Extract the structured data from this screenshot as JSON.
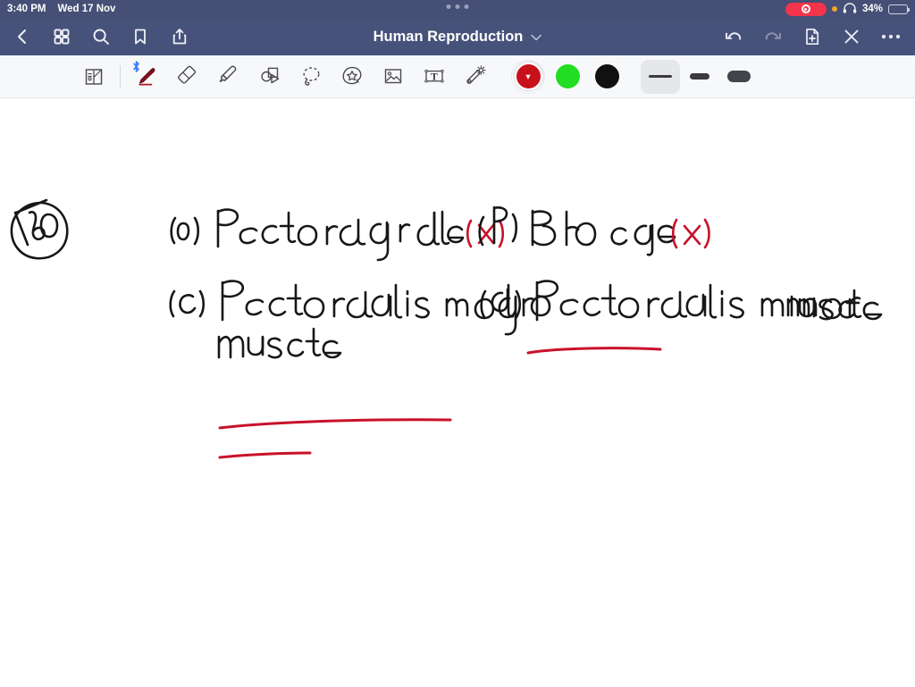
{
  "status_bar": {
    "time": "3:40 PM",
    "date": "Wed 17 Nov",
    "battery_percent": "34%",
    "recording_icon": "record-indicator",
    "orange_dot_icon": "microphone-in-use-dot",
    "headphones_icon": "headphones-icon",
    "battery_icon": "battery-icon",
    "multitask_handle_icon": "multitasking-handle"
  },
  "nav_bar": {
    "title": "Human Reproduction",
    "title_chevron_icon": "chevron-down-icon",
    "left_items": [
      {
        "name": "back-button",
        "icon": "chevron-left-icon"
      },
      {
        "name": "page-grid-button",
        "icon": "grid-icon"
      },
      {
        "name": "search-button",
        "icon": "search-icon"
      },
      {
        "name": "bookmark-button",
        "icon": "bookmark-icon"
      },
      {
        "name": "share-button",
        "icon": "share-icon"
      }
    ],
    "right_items": [
      {
        "name": "undo-button",
        "icon": "undo-icon",
        "enabled": "true"
      },
      {
        "name": "redo-button",
        "icon": "redo-icon",
        "enabled": "false"
      },
      {
        "name": "add-page-button",
        "icon": "add-page-icon"
      },
      {
        "name": "close-button",
        "icon": "close-icon"
      },
      {
        "name": "more-options-button",
        "icon": "ellipsis-icon"
      }
    ]
  },
  "toolbar": {
    "tools": [
      {
        "name": "page-layers-tool",
        "icon": "page-layers-icon",
        "selected": "false"
      },
      {
        "name": "pen-tool",
        "icon": "pen-icon",
        "selected": "true",
        "bluetooth_badge": "ᛒ"
      },
      {
        "name": "eraser-tool",
        "icon": "eraser-icon",
        "selected": "false"
      },
      {
        "name": "highlighter-tool",
        "icon": "highlighter-icon",
        "selected": "false"
      },
      {
        "name": "shapes-tool",
        "icon": "shapes-icon",
        "selected": "false"
      },
      {
        "name": "lasso-tool",
        "icon": "lasso-icon",
        "selected": "false"
      },
      {
        "name": "sticker-tool",
        "icon": "sticker-star-icon",
        "selected": "false"
      },
      {
        "name": "image-tool",
        "icon": "image-icon",
        "selected": "false"
      },
      {
        "name": "text-box-tool",
        "icon": "text-box-icon",
        "selected": "false"
      },
      {
        "name": "magic-wand-tool",
        "icon": "magic-wand-icon",
        "selected": "false"
      }
    ],
    "colors": [
      {
        "name": "color-swatch-red",
        "hex": "#c7101b",
        "selected": "true"
      },
      {
        "name": "color-swatch-green",
        "hex": "#22dd22",
        "selected": "false"
      },
      {
        "name": "color-swatch-black",
        "hex": "#111111",
        "selected": "false"
      }
    ],
    "stroke_widths": [
      {
        "name": "stroke-width-thin",
        "selected": "true"
      },
      {
        "name": "stroke-width-medium",
        "selected": "false"
      },
      {
        "name": "stroke-width-thick",
        "selected": "false"
      }
    ]
  },
  "canvas": {
    "page_number_annotation": "180",
    "ink_colors": {
      "black": "#171717",
      "red": "#c9112b"
    },
    "annotations": [
      {
        "name": "option-a",
        "text": "(a) Pectoral girdle(x)",
        "color": "black",
        "mark": "(x)",
        "mark_color": "red",
        "underlined": "false"
      },
      {
        "name": "option-b",
        "text": "(b) Rib cage(X)",
        "color": "black",
        "mark": "(X)",
        "mark_color": "red",
        "underlined": "true"
      },
      {
        "name": "option-c",
        "text": "(c) Pectoralis major muscle",
        "color": "black",
        "mark": "",
        "underlined": "true"
      },
      {
        "name": "option-d",
        "text": "(d) Pectoralis minor muscle",
        "color": "black",
        "mark": "",
        "underlined": "false"
      }
    ]
  }
}
